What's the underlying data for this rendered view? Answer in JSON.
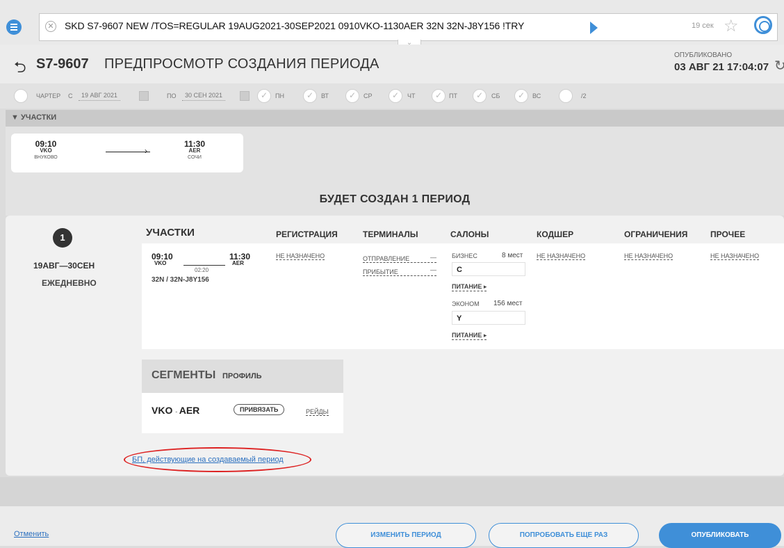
{
  "command": {
    "text": "SKD S7-9607 NEW /TOS=REGULAR 19AUG2021-30SEP2021 0910VKO-1130AER 32N 32N-J8Y156 !TRY",
    "timer": "19 сек"
  },
  "header": {
    "flight": "S7-9607",
    "title": "ПРЕДПРОСМОТР СОЗДАНИЯ ПЕРИОДА",
    "published_label": "ОПУБЛИКОВАНО",
    "published_date": "03 АВГ 21 17:04:07"
  },
  "filters": {
    "charter": "ЧАРТЕР",
    "from_label": "С",
    "from_date": "19 АВГ 2021",
    "to_label": "ПО",
    "to_date": "30 СЕН 2021",
    "days": [
      "ПН",
      "ВТ",
      "СР",
      "ЧТ",
      "ПТ",
      "СБ",
      "ВС"
    ],
    "every": "/2"
  },
  "section": {
    "title": "▼ УЧАСТКИ"
  },
  "leg_card": {
    "dep_time": "09:10",
    "dep_code": "VKO",
    "dep_city": "ВНУКОВО",
    "arr_time": "11:30",
    "arr_code": "AER",
    "arr_city": "СОЧИ"
  },
  "will_create": "БУДЕТ СОЗДАН 1 ПЕРИОД",
  "period": {
    "number": "1",
    "range": "19АВГ—30СЕН",
    "frequency": "ЕЖЕДНЕВНО",
    "columns": {
      "legs": "УЧАСТКИ",
      "registration": "РЕГИСТРАЦИЯ",
      "terminals": "ТЕРМИНАЛЫ",
      "salons": "САЛОНЫ",
      "codeshare": "КОДШЕР",
      "restrictions": "ОГРАНИЧЕНИЯ",
      "other": "ПРОЧЕЕ"
    },
    "leg": {
      "dep_time": "09:10",
      "dep_code": "VKO",
      "arr_time": "11:30",
      "arr_code": "AER",
      "duration": "02:20",
      "aircraft": "32N / 32N-J8Y156"
    },
    "not_assigned": "НЕ НАЗНАЧЕНО",
    "terminals": {
      "departure": "ОТПРАВЛЕНИЕ",
      "departure_value": "—",
      "arrival": "ПРИБЫТИЕ",
      "arrival_value": "—"
    },
    "salons": {
      "business": "БИЗНЕС",
      "business_seats": "8 мест",
      "business_class": "C",
      "economy": "ЭКОНОМ",
      "economy_seats": "156 мест",
      "economy_class": "Y",
      "meal": "ПИТАНИЕ ▸"
    }
  },
  "segments": {
    "title": "СЕГМЕНТЫ",
    "profile": "ПРОФИЛЬ",
    "route_from": "VKO",
    "route_to": "AER",
    "attach": "ПРИВЯЗАТЬ",
    "trips": "РЕЙДЫ"
  },
  "bp_link": "БП, действующие на создаваемый период",
  "footer": {
    "cancel": "Отменить",
    "change_period": "ИЗМЕНИТЬ ПЕРИОД",
    "retry": "ПОПРОБОВАТЬ ЕЩЕ РАЗ",
    "publish": "ОПУБЛИКОВАТЬ"
  }
}
